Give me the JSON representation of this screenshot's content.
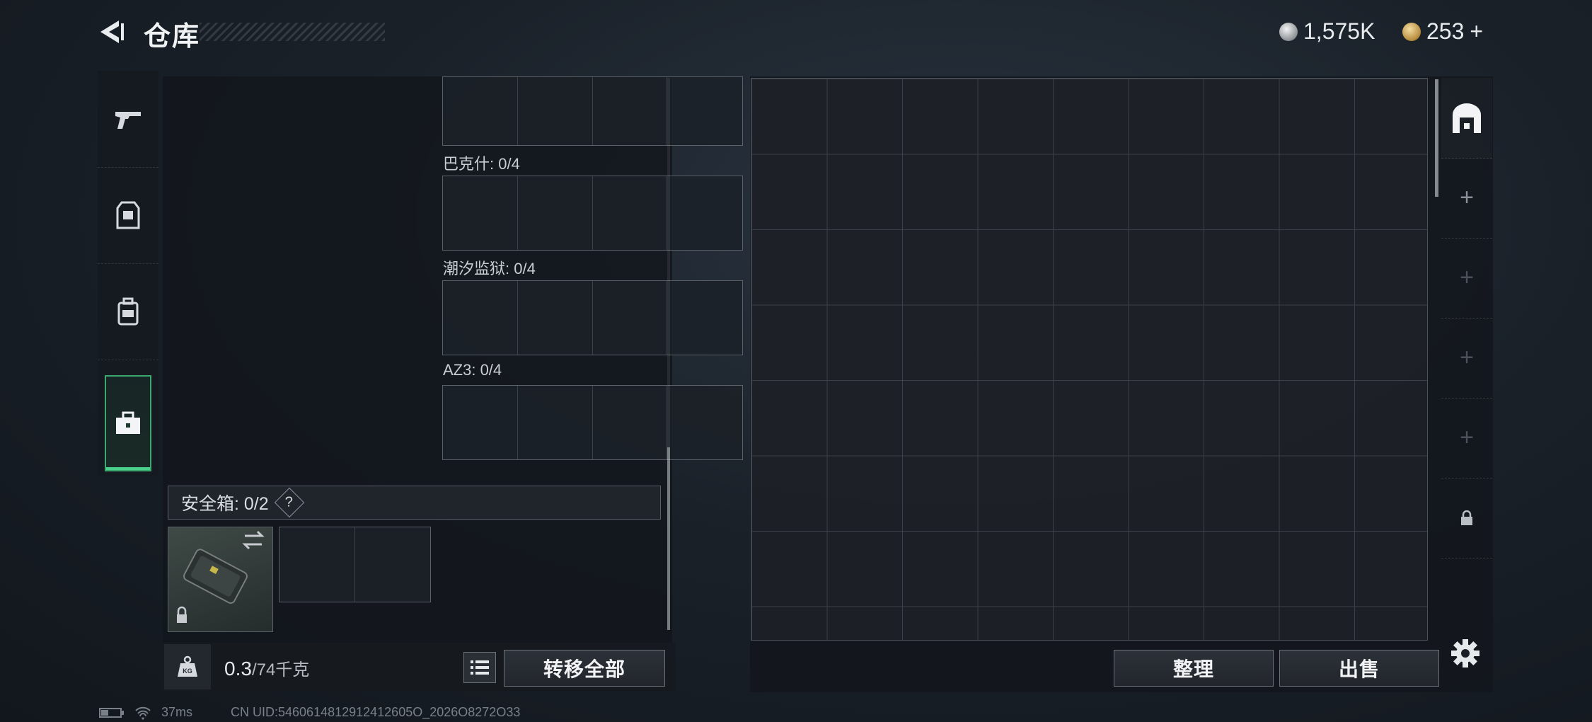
{
  "header": {
    "title": "仓库",
    "currency_silver": "1,575K",
    "currency_gold": "253",
    "add_symbol": "+"
  },
  "sidebar": {
    "items": [
      {
        "icon": "pistol-icon"
      },
      {
        "icon": "armor-vest-icon"
      },
      {
        "icon": "backpack-icon"
      },
      {
        "icon": "toolbox-icon",
        "active": true
      }
    ]
  },
  "keys": {
    "slots": [
      {
        "label": "巴克什: 0/4"
      },
      {
        "label": "潮汐监狱: 0/4"
      },
      {
        "label": "AZ3: 0/4"
      }
    ]
  },
  "safebox": {
    "label": "安全箱: 0/2",
    "help": "?"
  },
  "weight": {
    "current": "0.3",
    "max": "/74千克"
  },
  "buttons": {
    "transfer_all": "转移全部",
    "sort": "整理",
    "sell": "出售"
  },
  "status": {
    "ping": "37ms",
    "uid": "CN UID:5460614812912412605O_2026O8272O33"
  }
}
